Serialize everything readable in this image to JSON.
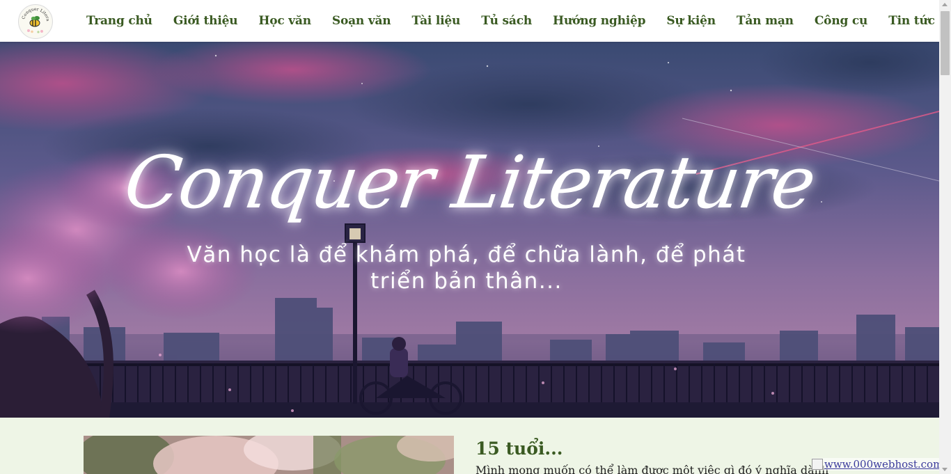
{
  "nav": {
    "items": [
      {
        "label": "Trang chủ"
      },
      {
        "label": "Giới thiệu"
      },
      {
        "label": "Học văn"
      },
      {
        "label": "Soạn văn"
      },
      {
        "label": "Tài liệu"
      },
      {
        "label": "Tủ sách"
      },
      {
        "label": "Hướng nghiệp"
      },
      {
        "label": "Sự kiện"
      },
      {
        "label": "Tản mạn"
      },
      {
        "label": "Công cụ"
      },
      {
        "label": "Tin tức"
      }
    ]
  },
  "logo": {
    "text": "Conquer Literature",
    "icon": "bee-icon"
  },
  "hero": {
    "title": "Conquer Literature",
    "subtitle_line1": "Văn học là để khám phá, để chữa lành, để phát",
    "subtitle_line2": "triển bản thân..."
  },
  "post": {
    "title": "15 tuổi...",
    "excerpt": "Mình mong muốn có thể làm được một việc gì đó ý nghĩa dành"
  },
  "host_badge": {
    "text": "www.000webhost.com"
  },
  "colors": {
    "nav_text": "#3a5a22",
    "content_bg": "#eef5e6",
    "link": "#3b3b9c"
  }
}
